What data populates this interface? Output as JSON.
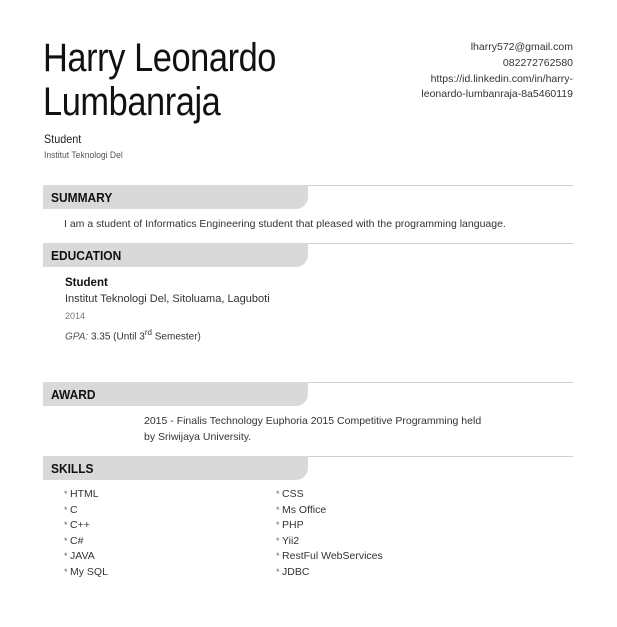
{
  "header": {
    "name_line1": "Harry Leonardo",
    "name_line2": "Lumbanraja",
    "role": "Student",
    "school": "Institut Teknologi Del"
  },
  "contact": {
    "email": "lharry572@gmail.com",
    "phone": "082272762580",
    "linkedin_line1": "https://id.linkedin.com/in/harry-",
    "linkedin_line2": "leonardo-lumbanraja-8a5460119"
  },
  "summary": {
    "title": "SUMMARY",
    "text": "I am a student of Informatics Engineering student that pleased with the programming language."
  },
  "education": {
    "title": "EDUCATION",
    "role": "Student",
    "school": "Institut Teknologi Del, Sitoluama, Laguboti",
    "year": "2014",
    "gpa_label": "GPA:",
    "gpa_value": "3.35 (Until 3",
    "gpa_sup": "rd",
    "gpa_suffix": " Semester)"
  },
  "award": {
    "title": "AWARD",
    "line1": "2015 - Finalis Technology Euphoria 2015 Competitive Programming held",
    "line2": "by Sriwijaya University."
  },
  "skills": {
    "title": "SKILLS",
    "left": [
      "HTML",
      "C",
      "C++",
      "C#",
      "JAVA",
      "My SQL"
    ],
    "right": [
      "CSS",
      "Ms Office",
      "PHP",
      "Yii2",
      "RestFul WebServices",
      "JDBC"
    ]
  }
}
